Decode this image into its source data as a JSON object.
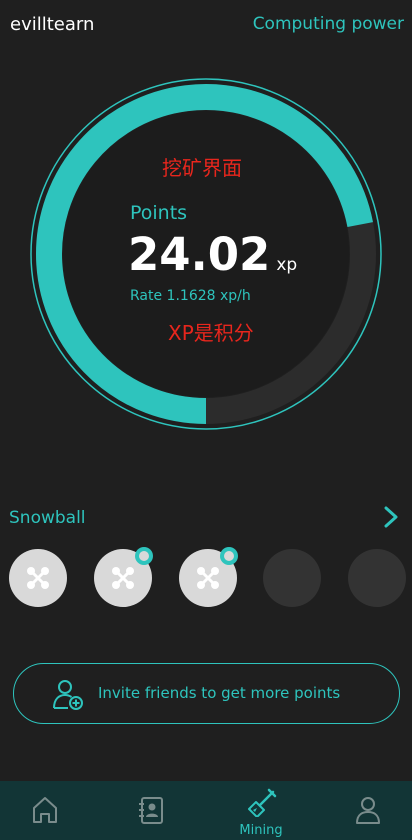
{
  "header": {
    "username": "evilltearn",
    "computing_power": "Computing power"
  },
  "mining": {
    "annotation_top": "挖矿界面",
    "annotation_bottom": "XP是积分",
    "points_label": "Points",
    "points_value": "24.02",
    "points_unit": "xp",
    "rate_text": "Rate 1.1628 xp/h",
    "progress_fraction": 0.72
  },
  "snowball": {
    "title": "Snowball",
    "slots": [
      {
        "state": "filled",
        "badge": false
      },
      {
        "state": "filled",
        "badge": true
      },
      {
        "state": "filled",
        "badge": true
      },
      {
        "state": "empty",
        "badge": false
      },
      {
        "state": "empty",
        "badge": false
      }
    ]
  },
  "invite": {
    "label": "Invite friends to get more points",
    "icon": "add-user-icon"
  },
  "tabs": [
    {
      "name": "home",
      "icon": "home-icon",
      "label": ""
    },
    {
      "name": "contacts",
      "icon": "contacts-icon",
      "label": ""
    },
    {
      "name": "mining",
      "icon": "shovel-icon",
      "label": "Mining",
      "active": true
    },
    {
      "name": "profile",
      "icon": "user-icon",
      "label": ""
    }
  ],
  "colors": {
    "accent": "#2ec4bd",
    "background": "#1f1f1f",
    "tabbar": "#123536",
    "annotation": "#e8261d"
  }
}
